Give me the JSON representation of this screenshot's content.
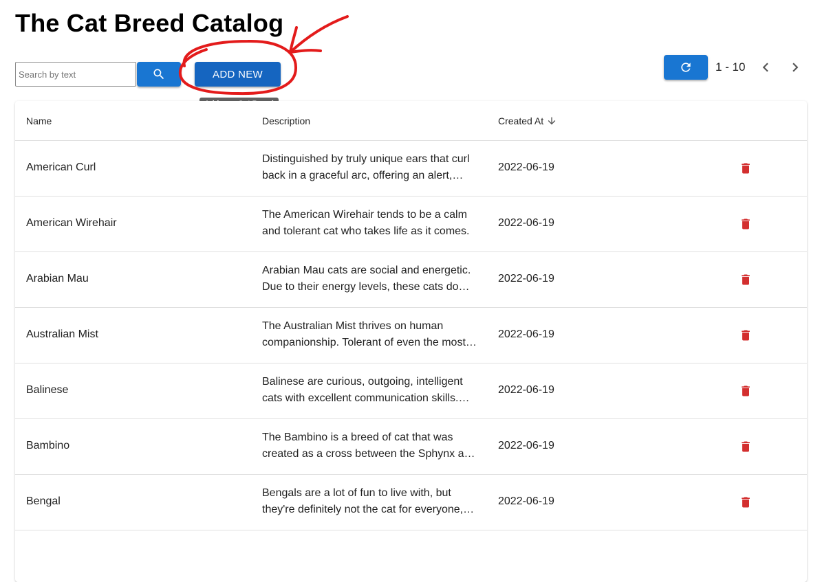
{
  "page": {
    "title": "The Cat Breed Catalog"
  },
  "toolbar": {
    "search_placeholder": "Search by text",
    "search_icon": "search-icon",
    "add_new_label": "ADD NEW",
    "add_new_tooltip": "Add new Cat Breed",
    "refresh_icon": "refresh-icon",
    "page_range": "1 - 10",
    "prev_icon": "chevron-left-icon",
    "next_icon": "chevron-right-icon"
  },
  "table": {
    "headers": {
      "name": "Name",
      "description": "Description",
      "created_at": "Created At"
    },
    "sort": {
      "column": "created_at",
      "direction": "descending",
      "icon": "arrow-down-icon"
    },
    "rows": [
      {
        "name": "American Curl",
        "description": "Distinguished by truly unique ears that curl back in a graceful arc, offering an alert, affectionate expression.",
        "created_at": "2022-06-19"
      },
      {
        "name": "American Wirehair",
        "description": "The American Wirehair tends to be a calm and tolerant cat who takes life as it comes.",
        "created_at": "2022-06-19"
      },
      {
        "name": "Arabian Mau",
        "description": "Arabian Mau cats are social and energetic. Due to their energy levels, these cats do best in homes.",
        "created_at": "2022-06-19"
      },
      {
        "name": "Australian Mist",
        "description": "The Australian Mist thrives on human companionship. Tolerant of even the most boisterous children.",
        "created_at": "2022-06-19"
      },
      {
        "name": "Balinese",
        "description": "Balinese are curious, outgoing, intelligent cats with excellent communication skills. They are known for their chatty personalities.",
        "created_at": "2022-06-19"
      },
      {
        "name": "Bambino",
        "description": "The Bambino is a breed of cat that was created as a cross between the Sphynx and the Munchkin breeds.",
        "created_at": "2022-06-19"
      },
      {
        "name": "Bengal",
        "description": "Bengals are a lot of fun to live with, but they're definitely not the cat for everyone, or for first-time cat owners.",
        "created_at": "2022-06-19"
      }
    ],
    "delete_icon": "trash-icon"
  },
  "colors": {
    "primary": "#1976d2",
    "add_button": "#1565c0",
    "delete": "#d32f2f",
    "annotation": "#e31b1b"
  }
}
